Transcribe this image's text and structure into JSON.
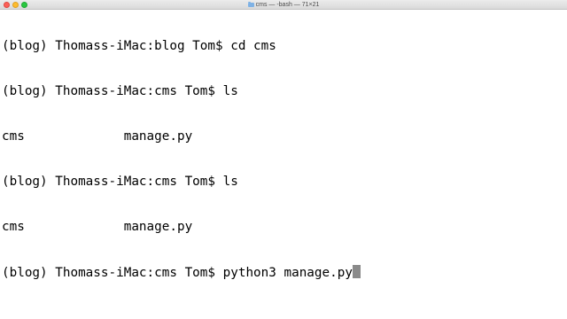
{
  "window": {
    "title": "cms — -bash — 71×21"
  },
  "terminal": {
    "lines": [
      "(blog) Thomass-iMac:blog Tom$ cd cms",
      "(blog) Thomass-iMac:cms Tom$ ls",
      "cms             manage.py",
      "(blog) Thomass-iMac:cms Tom$ ls",
      "cms             manage.py",
      "(blog) Thomass-iMac:cms Tom$ python3 manage.py"
    ]
  }
}
